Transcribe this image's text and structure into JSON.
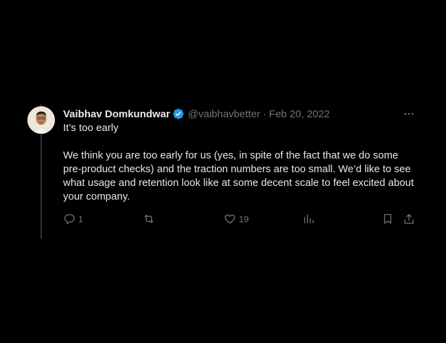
{
  "tweet": {
    "author": {
      "display_name": "Vaibhav Domkundwar",
      "handle": "@vaibhavbetter",
      "verified": true
    },
    "separator": "·",
    "date": "Feb 20, 2022",
    "title": "It’s too early",
    "body": "We think you are too early for us (yes, in spite of the fact that we do some pre-product checks) and the traction numbers are too small. We’d like to see what usage and retention look like at some decent scale to feel excited about your company.",
    "actions": {
      "reply_count": "1",
      "retweet_count": "",
      "like_count": "19",
      "views_count": ""
    }
  },
  "icons": {
    "verified": "verified-badge-icon",
    "more": "more-dots-icon",
    "reply": "reply-icon",
    "retweet": "retweet-icon",
    "like": "heart-icon",
    "views": "views-chart-icon",
    "bookmark": "bookmark-icon",
    "share": "share-icon"
  },
  "colors": {
    "background": "#000000",
    "text_primary": "#e7e9ea",
    "text_secondary": "#71767b",
    "verified_blue": "#1d9bf0",
    "thread_line": "#333639"
  }
}
